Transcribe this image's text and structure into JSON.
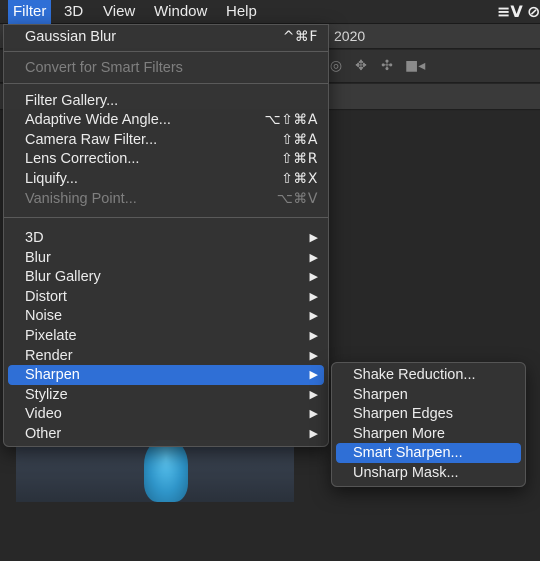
{
  "menubar": {
    "items": [
      "Filter",
      "3D",
      "View",
      "Window",
      "Help"
    ],
    "status_icons": [
      "creative-cloud-icon",
      "sync-icon"
    ],
    "status_glyphs": [
      "≡V",
      "⊘"
    ]
  },
  "document": {
    "tab_title_fragment": "2020"
  },
  "filter_menu": {
    "last_filter": {
      "label": "Gaussian Blur",
      "shortcut": "^⌘F"
    },
    "convert_smart": {
      "label": "Convert for Smart Filters"
    },
    "items": [
      {
        "label": "Filter Gallery...",
        "shortcut": ""
      },
      {
        "label": "Adaptive Wide Angle...",
        "shortcut": "⌥⇧⌘A"
      },
      {
        "label": "Camera Raw Filter...",
        "shortcut": "⇧⌘A"
      },
      {
        "label": "Lens Correction...",
        "shortcut": "⇧⌘R"
      },
      {
        "label": "Liquify...",
        "shortcut": "⇧⌘X"
      },
      {
        "label": "Vanishing Point...",
        "shortcut": "⌥⌘V"
      }
    ],
    "submenus": [
      "3D",
      "Blur",
      "Blur Gallery",
      "Distort",
      "Noise",
      "Pixelate",
      "Render",
      "Sharpen",
      "Stylize",
      "Video",
      "Other"
    ],
    "arrow_glyph": "▶"
  },
  "sharpen_menu": {
    "items": [
      "Shake Reduction...",
      "Sharpen",
      "Sharpen Edges",
      "Sharpen More",
      "Smart Sharpen...",
      "Unsharp Mask..."
    ]
  },
  "colors": {
    "highlight": "#2f6fd6",
    "menu_bg": "#343434",
    "disabled_text": "#7f7f7f"
  }
}
